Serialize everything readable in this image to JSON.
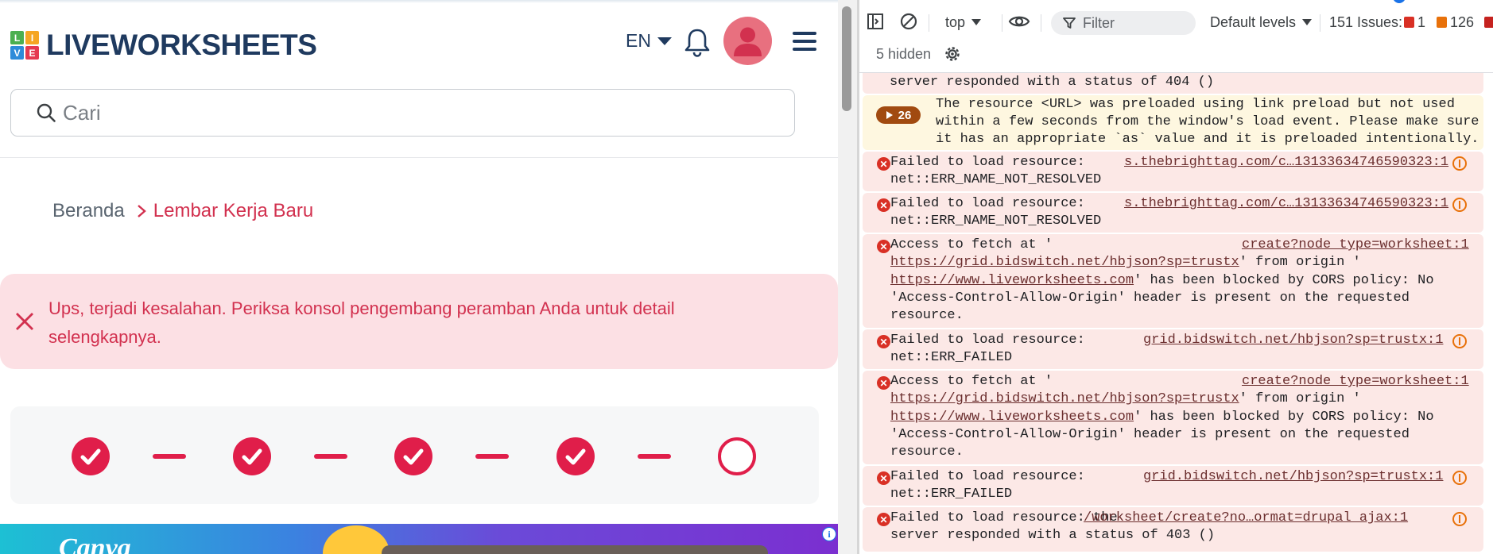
{
  "site": {
    "logo": {
      "letters": [
        "L",
        "I",
        "V",
        "E"
      ],
      "letter_colors": [
        "#4caf50",
        "#f5a623",
        "#2e8bd9",
        "#e53950"
      ],
      "text": "LIVEWORKSHEETS"
    },
    "header": {
      "language": "EN",
      "bell_icon": "bell-icon",
      "avatar_icon": "user-avatar-icon",
      "menu_icon": "hamburger-menu-icon"
    },
    "search": {
      "placeholder": "Cari",
      "value": ""
    },
    "breadcrumb": {
      "home": "Beranda",
      "current": "Lembar Kerja Baru"
    },
    "alert": {
      "message": "Ups, terjadi kesalahan. Periksa konsol pengembang peramban Anda untuk detail selengkapnya."
    },
    "steps": {
      "total": 5,
      "completed": 4
    },
    "ad": {
      "banner_text": "Canva",
      "info_label": "i"
    },
    "colors": {
      "brand_navy": "#1f3a5f",
      "accent_red": "#e01e4a",
      "alert_bg": "#fce0e4",
      "alert_text": "#d2314f"
    }
  },
  "devtools": {
    "toolbar": {
      "context": "top",
      "filter_placeholder": "Filter",
      "levels": "Default levels",
      "issues_label": "151 Issues:",
      "issues_error": "1",
      "issues_warning": "126",
      "hidden": "5 hidden"
    },
    "log": [
      {
        "type": "error",
        "lines": [
          "server responded with a status of 404 ()"
        ]
      },
      {
        "type": "warning",
        "count": "26",
        "lines": [
          "The resource <URL> was preloaded using link preload but not used",
          "within a few seconds from the window's load event. Please make sure",
          "it has an appropriate `as` value and it is preloaded intentionally."
        ]
      },
      {
        "type": "error",
        "lines": [
          "Failed to load resource:",
          "net::ERR_NAME_NOT_RESOLVED"
        ],
        "source": "s.thebrighttag.com/c…13133634746590323:1"
      },
      {
        "type": "error",
        "lines": [
          "Failed to load resource:",
          "net::ERR_NAME_NOT_RESOLVED"
        ],
        "source": "s.thebrighttag.com/c…13133634746590323:1"
      },
      {
        "type": "error",
        "prefix": "Access to fetch at '",
        "source": "create?node_type=worksheet:1",
        "url": "https://grid.bidswitch.net/hbjson?sp=trustx",
        "mid": "' from origin '",
        "origin": "https://www.liveworksheets.com",
        "tail": "' has been blocked by CORS policy: No",
        "lines": [
          "'Access-Control-Allow-Origin' header is present on the requested",
          "resource."
        ]
      },
      {
        "type": "error",
        "lines": [
          "Failed to load resource:",
          "net::ERR_FAILED"
        ],
        "source": "grid.bidswitch.net/hbjson?sp=trustx:1"
      },
      {
        "type": "error",
        "prefix": "Access to fetch at '",
        "source": "create?node_type=worksheet:1",
        "url": "https://grid.bidswitch.net/hbjson?sp=trustx",
        "mid": "' from origin '",
        "origin": "https://www.liveworksheets.com",
        "tail": "' has been blocked by CORS policy: No",
        "lines": [
          "'Access-Control-Allow-Origin' header is present on the requested",
          "resource."
        ]
      },
      {
        "type": "error",
        "lines": [
          "Failed to load resource:",
          "net::ERR_FAILED"
        ],
        "source": "grid.bidswitch.net/hbjson?sp=trustx:1"
      },
      {
        "type": "error",
        "lines": [
          "Failed to load resource: the",
          "server responded with a status of 403 ()"
        ],
        "source": "/worksheet/create?no…ormat=drupal_ajax:1"
      }
    ],
    "colors": {
      "error_bg": "#fce8e6",
      "warning_bg": "#fef7e0",
      "error_icon": "#d93025",
      "warning_pill": "#a14a10"
    }
  }
}
